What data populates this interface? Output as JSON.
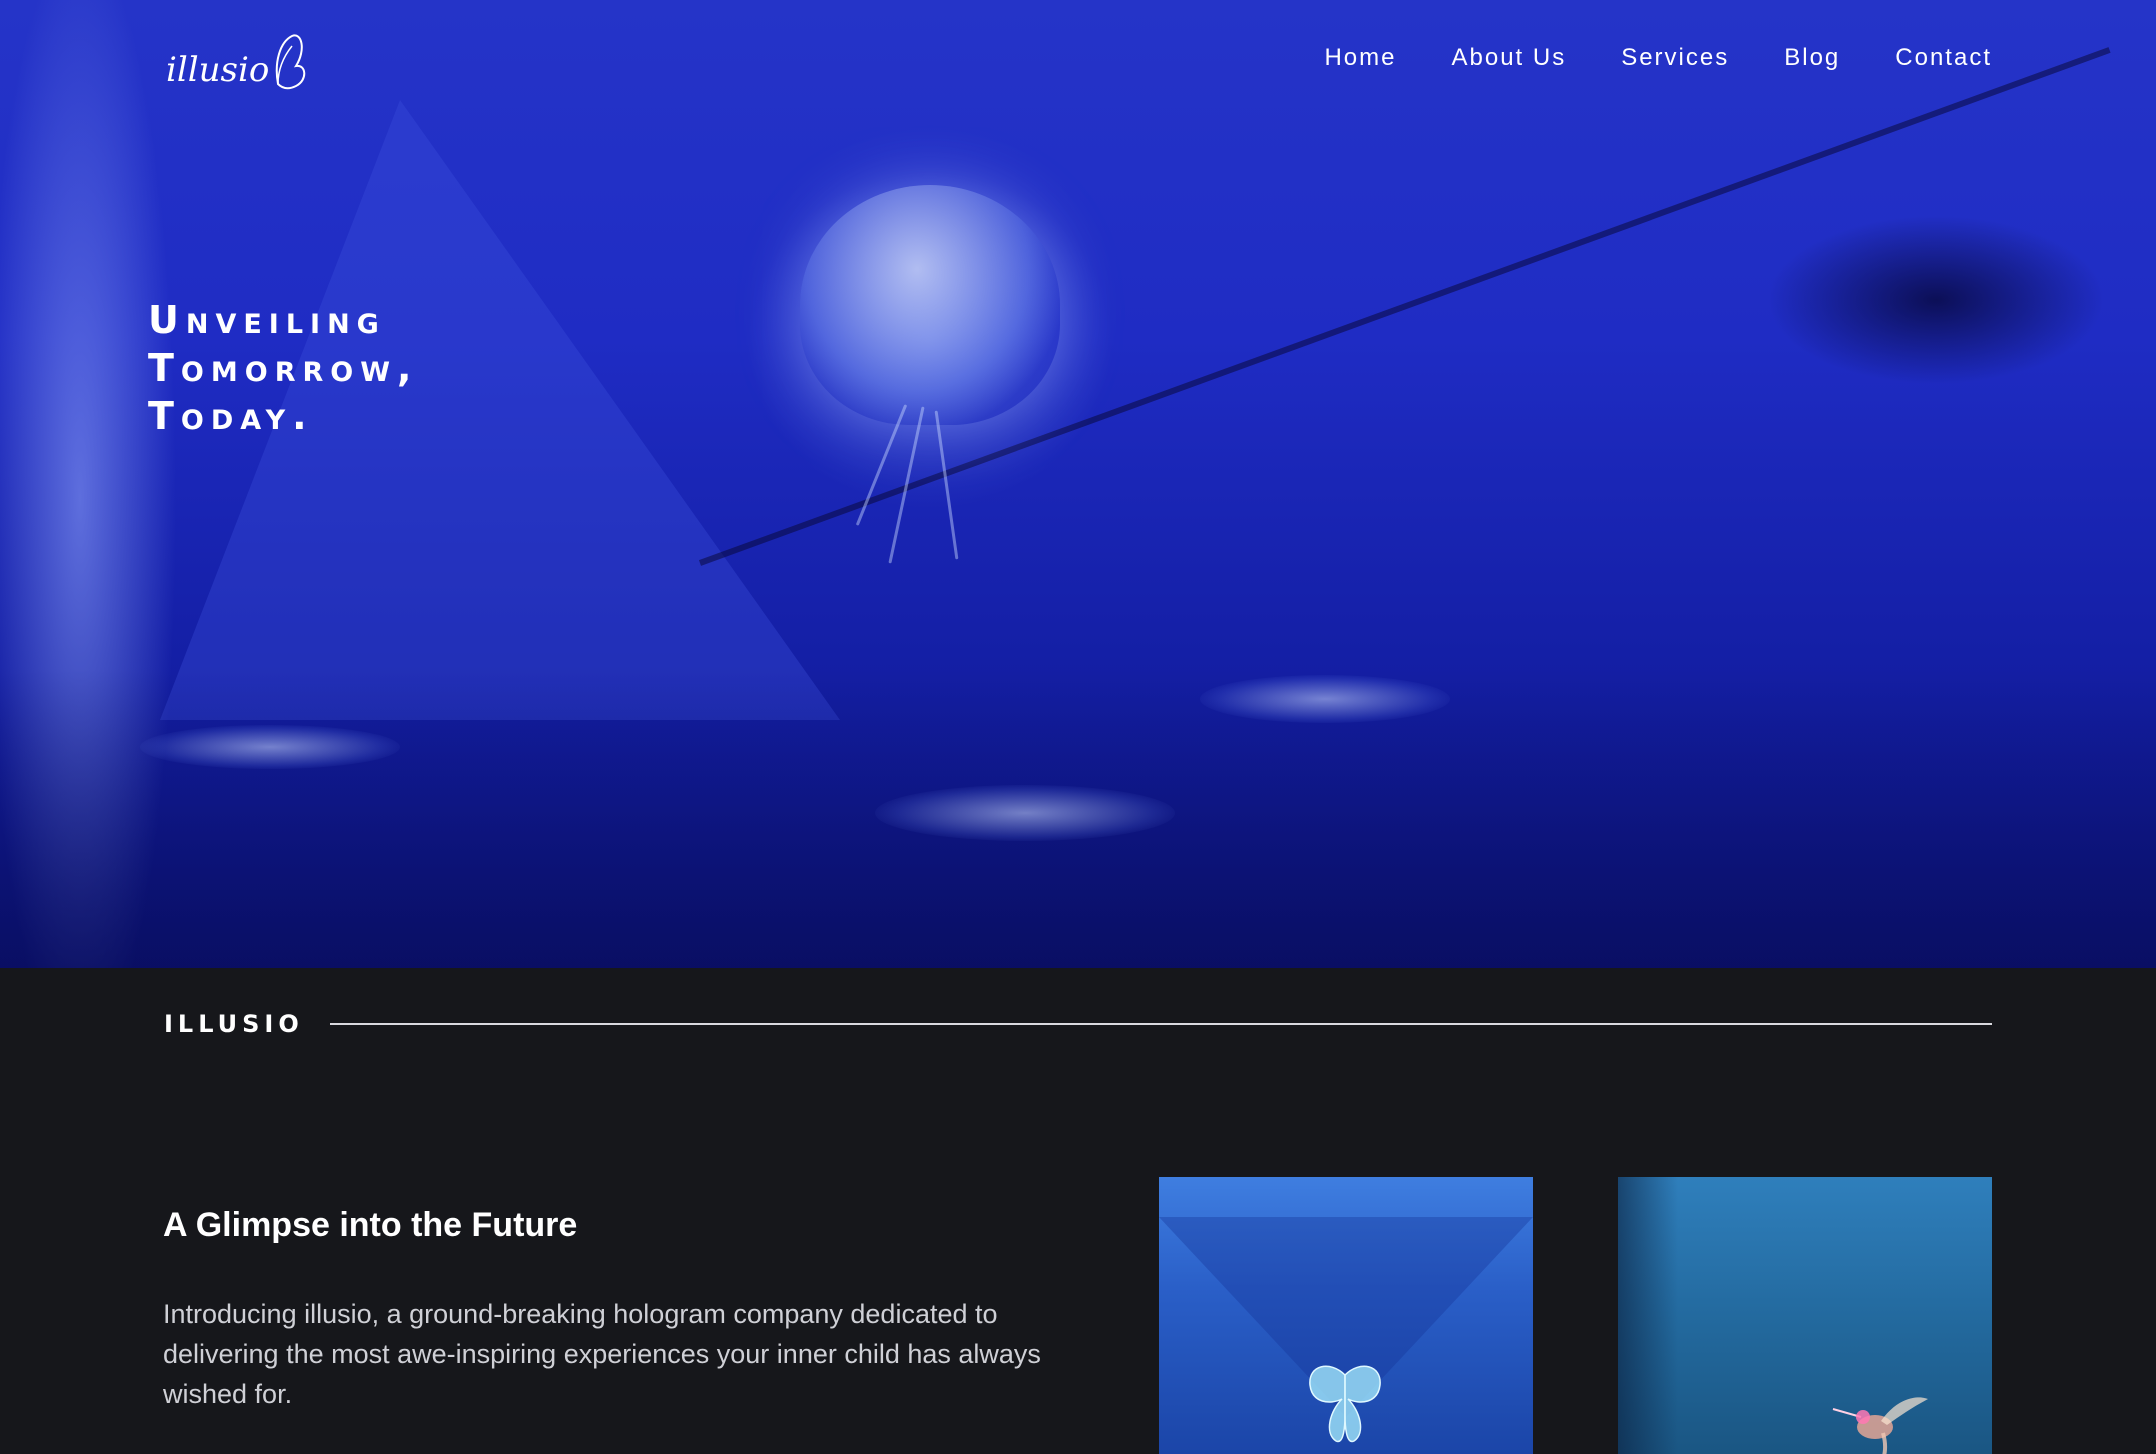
{
  "brand": {
    "logo_text": "illusio"
  },
  "nav": {
    "items": [
      {
        "label": "Home"
      },
      {
        "label": "About Us"
      },
      {
        "label": "Services"
      },
      {
        "label": "Blog"
      },
      {
        "label": "Contact"
      }
    ]
  },
  "hero": {
    "tagline_lines": [
      "Unveiling",
      "Tomorrow,",
      "Today."
    ]
  },
  "section": {
    "title": "illusio"
  },
  "intro": {
    "heading": "A Glimpse into the Future",
    "body": "Introducing illusio, a ground-breaking hologram company dedicated to delivering the most awe-inspiring experiences your inner child has always wished for."
  },
  "icons": {
    "logo": "butterfly-icon",
    "card1": "butterfly-hologram",
    "card2": "hummingbird-hologram"
  },
  "colors": {
    "hero_blue": "#1f2cc4",
    "page_bg": "#16171b",
    "text_white": "#ffffff",
    "body_text": "#cfd0d6"
  }
}
